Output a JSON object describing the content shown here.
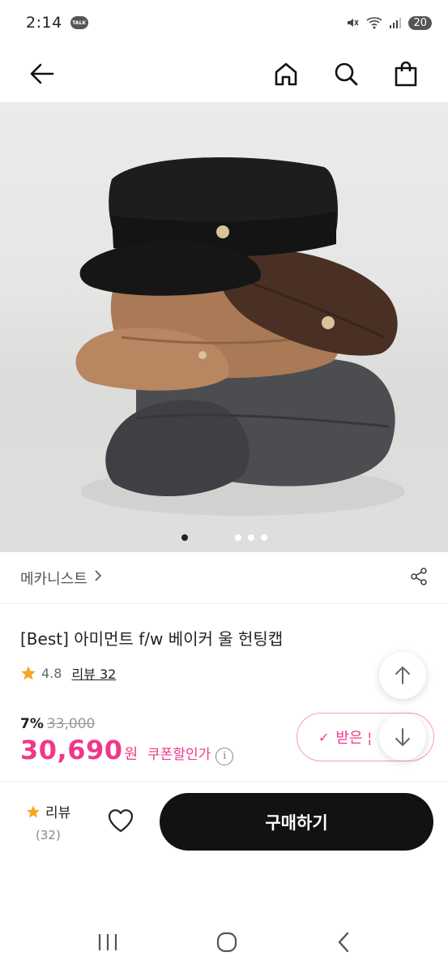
{
  "status_bar": {
    "time": "2:14",
    "talk_badge": "TALK",
    "battery": "20"
  },
  "nav": {
    "back_icon": "arrow-left-icon",
    "home_icon": "home-icon",
    "search_icon": "search-icon",
    "cart_icon": "shopping-bag-icon"
  },
  "product": {
    "brand": "메카니스트",
    "brand_chevron": ">",
    "title": "[Best] 아미먼트 f/w 베이커 울 헌팅캡",
    "rating": "4.8",
    "review_link": "리뷰 32",
    "discount": "7%",
    "original_price": "33,000",
    "price": "30,690",
    "price_unit": "원",
    "coupon_text": "쿠폰할인가",
    "info_glyph": "i",
    "coupon_button": "받은 ¦",
    "coupon_check": "✓",
    "image_dots": 4,
    "image_active_index": 0
  },
  "action_bar": {
    "review_label": "리뷰",
    "review_count": "(32)",
    "buy_label": "구매하기"
  },
  "colors": {
    "accent_pink": "#f0388a",
    "star": "#f5a623",
    "buy_button": "#121212"
  }
}
